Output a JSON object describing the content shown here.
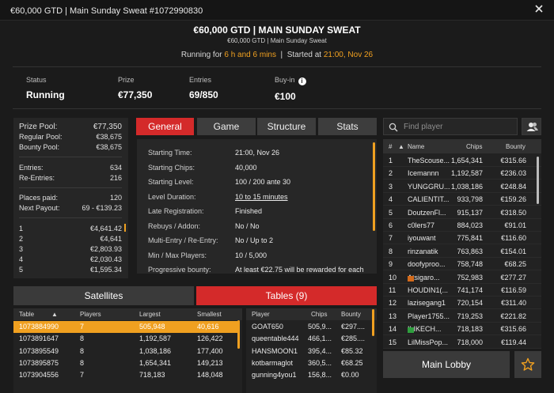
{
  "window": {
    "title": "€60,000 GTD | Main Sunday Sweat #1072990830"
  },
  "header": {
    "title": "€60,000 GTD | MAIN SUNDAY SWEAT",
    "subtitle": "€60,000 GTD | Main Sunday Sweat",
    "running_prefix": "Running for",
    "running_duration": "6 h and 6 mins",
    "started_label": "Started at",
    "started_time": "21:00, Nov 26"
  },
  "stats": {
    "status_label": "Status",
    "status_value": "Running",
    "prize_label": "Prize",
    "prize_value": "€77,350",
    "entries_label": "Entries",
    "entries_value": "69/850",
    "buyin_label": "Buy-in",
    "buyin_value": "€100"
  },
  "prize_panel": {
    "prize_pool_label": "Prize Pool:",
    "prize_pool": "€77,350",
    "regular_pool_label": "Regular Pool:",
    "regular_pool": "€38,675",
    "bounty_pool_label": "Bounty Pool:",
    "bounty_pool": "€38,675",
    "entries_label": "Entries:",
    "entries": "634",
    "reentries_label": "Re-Entries:",
    "reentries": "216",
    "places_paid_label": "Places paid:",
    "places_paid": "120",
    "next_payout_label": "Next Payout:",
    "next_payout": "69 - €139.23",
    "payouts": [
      {
        "place": "1",
        "amount": "€4,641.42"
      },
      {
        "place": "2",
        "amount": "€4,641"
      },
      {
        "place": "3",
        "amount": "€2,803.93"
      },
      {
        "place": "4",
        "amount": "€2,030.43"
      },
      {
        "place": "5",
        "amount": "€1,595.34"
      }
    ]
  },
  "tabs": {
    "general": "General",
    "game": "Game",
    "structure": "Structure",
    "stats": "Stats"
  },
  "general_info": [
    {
      "label": "Starting Time:",
      "value": "21:00, Nov 26"
    },
    {
      "label": "Starting Chips:",
      "value": "40,000"
    },
    {
      "label": "Starting Level:",
      "value": "100 / 200 ante 30"
    },
    {
      "label": "Level Duration:",
      "value": "10 to 15 minutes"
    },
    {
      "label": "Late Registration:",
      "value": "Finished"
    },
    {
      "label": "Rebuys / Addon:",
      "value": "No / No"
    },
    {
      "label": "Multi-Entry / Re-Entry:",
      "value": "No / Up to 2"
    },
    {
      "label": "Min / Max Players:",
      "value": "10 / 5,000"
    },
    {
      "label": "Progressive bounty:",
      "value": "At least €22.75 will be rewarded for each"
    }
  ],
  "search": {
    "placeholder": "Find player"
  },
  "players_table": {
    "headers": {
      "rank": "#",
      "name": "Name",
      "chips": "Chips",
      "bounty": "Bounty"
    },
    "rows": [
      {
        "rank": "1",
        "name": "TheScouse...",
        "chips": "1,654,341",
        "bounty": "€315.66"
      },
      {
        "rank": "2",
        "name": "Icemannn",
        "chips": "1,192,587",
        "bounty": "€236.03"
      },
      {
        "rank": "3",
        "name": "YUNGGRU...",
        "chips": "1,038,186",
        "bounty": "€248.84"
      },
      {
        "rank": "4",
        "name": "CALIENTIT...",
        "chips": "933,798",
        "bounty": "€159.26"
      },
      {
        "rank": "5",
        "name": "DoutzenFl...",
        "chips": "915,137",
        "bounty": "€318.50"
      },
      {
        "rank": "6",
        "name": "c0lers77",
        "chips": "884,023",
        "bounty": "€91.01"
      },
      {
        "rank": "7",
        "name": "iyouwant",
        "chips": "775,841",
        "bounty": "€116.60"
      },
      {
        "rank": "8",
        "name": "rinzanatik",
        "chips": "763,863",
        "bounty": "€154.01"
      },
      {
        "rank": "9",
        "name": "doofyproo...",
        "chips": "758,748",
        "bounty": "€68.25"
      },
      {
        "rank": "10",
        "name": "Atsigaro...",
        "chips": "752,983",
        "bounty": "€277.27",
        "flag": "#d46a1a"
      },
      {
        "rank": "11",
        "name": "HOUDIN1(...",
        "chips": "741,174",
        "bounty": "€116.59"
      },
      {
        "rank": "12",
        "name": "lazisegang1",
        "chips": "720,154",
        "bounty": "€311.40"
      },
      {
        "rank": "13",
        "name": "Player1755...",
        "chips": "719,253",
        "bounty": "€221.82"
      },
      {
        "rank": "14",
        "name": "ILIKECH...",
        "chips": "718,183",
        "bounty": "€315.66",
        "flag": "#2e9e3e"
      },
      {
        "rank": "15",
        "name": "LilMissPop...",
        "chips": "718,000",
        "bounty": "€119.44"
      }
    ]
  },
  "buttons": {
    "main_lobby": "Main Lobby",
    "satellites": "Satellites",
    "tables": "Tables (9)"
  },
  "tables_list": {
    "headers": {
      "table": "Table",
      "players": "Players",
      "largest": "Largest",
      "smallest": "Smallest"
    },
    "rows": [
      {
        "table": "1073884990",
        "players": "7",
        "largest": "505,948",
        "smallest": "40,616"
      },
      {
        "table": "1073891647",
        "players": "8",
        "largest": "1,192,587",
        "smallest": "126,422"
      },
      {
        "table": "1073895549",
        "players": "8",
        "largest": "1,038,186",
        "smallest": "177,400"
      },
      {
        "table": "1073895875",
        "players": "8",
        "largest": "1,654,341",
        "smallest": "149,213"
      },
      {
        "table": "1073904556",
        "players": "7",
        "largest": "718,183",
        "smallest": "148,048"
      }
    ]
  },
  "seats_list": {
    "headers": {
      "player": "Player",
      "chips": "Chips",
      "bounty": "Bounty"
    },
    "rows": [
      {
        "player": "GOAT650",
        "chips": "505,9...",
        "bounty": "€297...."
      },
      {
        "player": "queentable444",
        "chips": "466,1...",
        "bounty": "€285...."
      },
      {
        "player": "HANSMOON1",
        "chips": "395,4...",
        "bounty": "€85.32"
      },
      {
        "player": "kotbarmaglot",
        "chips": "360,5...",
        "bounty": "€68.25"
      },
      {
        "player": "gunning4you1",
        "chips": "156,8...",
        "bounty": "€0.00"
      }
    ]
  },
  "colors": {
    "accent_red": "#d42a2a",
    "accent_orange": "#f0a020"
  },
  "icons": [
    "close-icon",
    "info-icon",
    "search-icon",
    "players-icon",
    "star-icon",
    "sort-asc-icon"
  ]
}
